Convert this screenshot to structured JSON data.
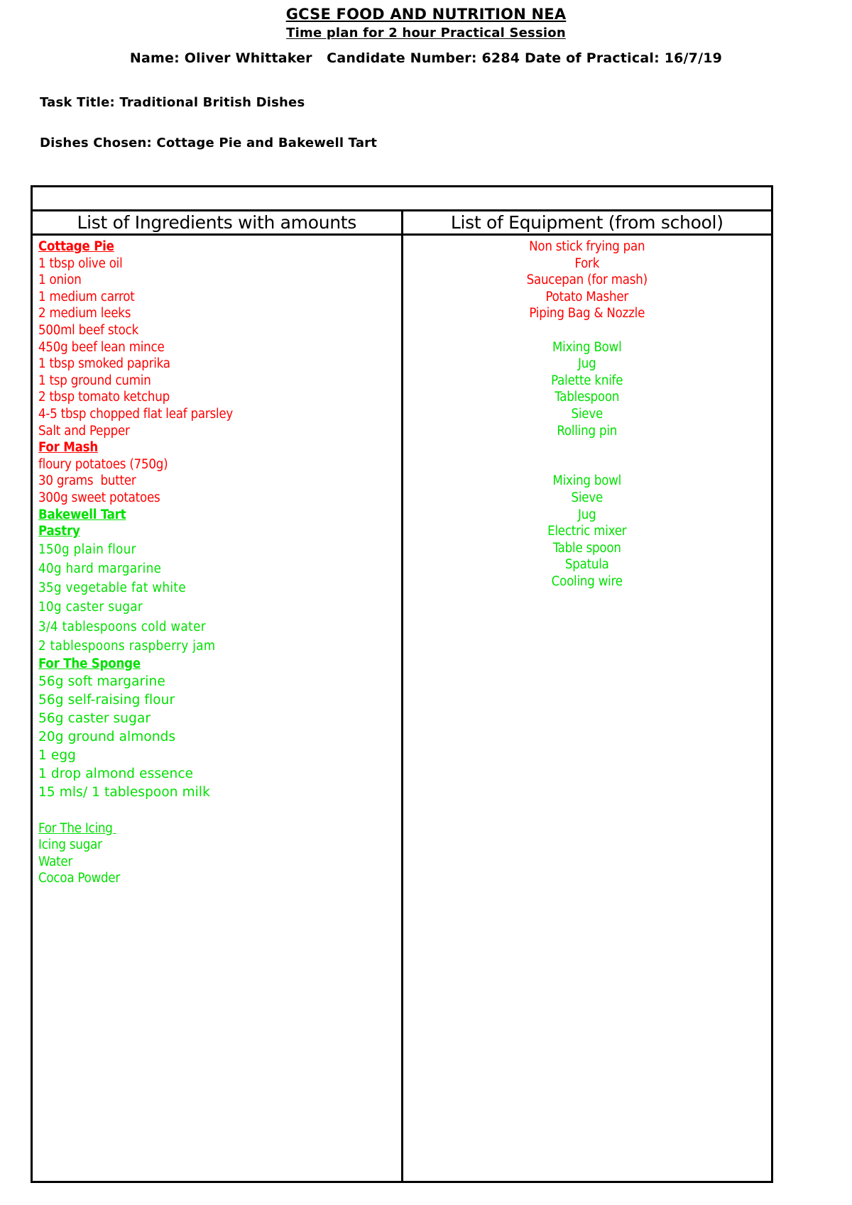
{
  "document": {
    "title_line_1": "GCSE FOOD AND NUTRITION NEA ",
    "title_line_2": "Time plan for 2 hour Practical Session  ",
    "name_label": "Name: ",
    "name_value": "Oliver Whittaker",
    "candidate_label": "   Candidate Number: ",
    "candidate_value": "6284",
    "date_label": " Date of Practical: ",
    "date_value": "16/7/19",
    "task_title_label": "Task Title: ",
    "task_title_value": "Traditional British Dishes",
    "dishes_chosen_label": "Dishes Chosen: ",
    "dishes_chosen_value": "Cottage Pie and Bakewell Tart"
  },
  "colors": {
    "red": "#ff0000",
    "green": "#00e000",
    "black": "#000000",
    "border": "#000000"
  },
  "table": {
    "blank_row": "",
    "headers": {
      "ingredients": "List of Ingredients with amounts",
      "equipment": "List of Equipment (from school)"
    },
    "ingredients": [
      {
        "text": "Cottage Pie",
        "color": "#ff0000",
        "bold": true,
        "underline": true,
        "font": "condensed"
      },
      {
        "text": "1 tbsp olive oil",
        "color": "#ff0000",
        "bold": false,
        "underline": false,
        "font": "condensed"
      },
      {
        "text": "1 onion",
        "color": "#ff0000",
        "bold": false,
        "underline": false,
        "font": "condensed"
      },
      {
        "text": "1 medium carrot",
        "color": "#ff0000",
        "bold": false,
        "underline": false,
        "font": "condensed"
      },
      {
        "text": "2 medium leeks",
        "color": "#ff0000",
        "bold": false,
        "underline": false,
        "font": "condensed"
      },
      {
        "text": "500ml beef stock",
        "color": "#ff0000",
        "bold": false,
        "underline": false,
        "font": "condensed"
      },
      {
        "text": "450g beef lean mince",
        "color": "#ff0000",
        "bold": false,
        "underline": false,
        "font": "condensed"
      },
      {
        "text": "1 tbsp smoked paprika",
        "color": "#ff0000",
        "bold": false,
        "underline": false,
        "font": "condensed"
      },
      {
        "text": "1 tsp ground cumin",
        "color": "#ff0000",
        "bold": false,
        "underline": false,
        "font": "condensed"
      },
      {
        "text": "2 tbsp tomato ketchup",
        "color": "#ff0000",
        "bold": false,
        "underline": false,
        "font": "condensed"
      },
      {
        "text": "4-5 tbsp chopped flat leaf parsley",
        "color": "#ff0000",
        "bold": false,
        "underline": false,
        "font": "condensed"
      },
      {
        "text": "Salt and Pepper",
        "color": "#ff0000",
        "bold": false,
        "underline": false,
        "font": "condensed"
      },
      {
        "text": "For Mash",
        "color": "#ff0000",
        "bold": true,
        "underline": true,
        "font": "condensed"
      },
      {
        "text": "floury potatoes (750g)",
        "color": "#ff0000",
        "bold": false,
        "underline": false,
        "font": "condensed"
      },
      {
        "text": "30 grams  butter",
        "color": "#ff0000",
        "bold": false,
        "underline": false,
        "font": "condensed"
      },
      {
        "text": "300g sweet potatoes",
        "color": "#ff0000",
        "bold": false,
        "underline": false,
        "font": "condensed"
      },
      {
        "text": "Bakewell Tart",
        "color": "#00e000",
        "bold": true,
        "underline": true,
        "font": "condensed"
      },
      {
        "text": "Pastry",
        "color": "#00e000",
        "bold": true,
        "underline": true,
        "font": "condensed"
      },
      {
        "text": "150g plain flour",
        "color": "#00e000",
        "bold": false,
        "underline": false,
        "font": "alt"
      },
      {
        "text": "40g hard margarine",
        "color": "#00e000",
        "bold": false,
        "underline": false,
        "font": "alt"
      },
      {
        "text": "35g vegetable fat white",
        "color": "#00e000",
        "bold": false,
        "underline": false,
        "font": "alt"
      },
      {
        "text": "10g caster sugar",
        "color": "#00e000",
        "bold": false,
        "underline": false,
        "font": "alt"
      },
      {
        "text": "3/4 tablespoons cold water",
        "color": "#00e000",
        "bold": false,
        "underline": false,
        "font": "alt"
      },
      {
        "text": "2 tablespoons raspberry jam",
        "color": "#00e000",
        "bold": false,
        "underline": false,
        "font": "alt"
      },
      {
        "text": "For The Sponge",
        "color": "#00e000",
        "bold": true,
        "underline": true,
        "font": "condensed"
      },
      {
        "text": "56g soft margarine",
        "color": "#00e000",
        "bold": false,
        "underline": false,
        "font": "alt2"
      },
      {
        "text": "56g self-raising flour",
        "color": "#00e000",
        "bold": false,
        "underline": false,
        "font": "alt2"
      },
      {
        "text": "56g caster sugar",
        "color": "#00e000",
        "bold": false,
        "underline": false,
        "font": "alt2"
      },
      {
        "text": "20g ground almonds",
        "color": "#00e000",
        "bold": false,
        "underline": false,
        "font": "alt2"
      },
      {
        "text": "1 egg",
        "color": "#00e000",
        "bold": false,
        "underline": false,
        "font": "alt2"
      },
      {
        "text": "1 drop almond essence",
        "color": "#00e000",
        "bold": false,
        "underline": false,
        "font": "alt2"
      },
      {
        "text": "15 mls/ 1 tablespoon milk",
        "color": "#00e000",
        "bold": false,
        "underline": false,
        "font": "alt2"
      },
      {
        "text": "",
        "color": "#00e000",
        "bold": false,
        "underline": false,
        "font": "alt2"
      },
      {
        "text": "For The Icing ",
        "color": "#00e000",
        "bold": false,
        "underline": true,
        "font": "condensed"
      },
      {
        "text": "Icing sugar",
        "color": "#00e000",
        "bold": false,
        "underline": false,
        "font": "condensed"
      },
      {
        "text": "Water",
        "color": "#00e000",
        "bold": false,
        "underline": false,
        "font": "condensed"
      },
      {
        "text": "Cocoa Powder",
        "color": "#00e000",
        "bold": false,
        "underline": false,
        "font": "condensed"
      }
    ],
    "equipment": [
      {
        "text": "Non stick frying pan",
        "color": "#ff0000"
      },
      {
        "text": "Fork",
        "color": "#ff0000"
      },
      {
        "text": "Saucepan (for mash)",
        "color": "#ff0000"
      },
      {
        "text": "Potato Masher",
        "color": "#ff0000"
      },
      {
        "text": "Piping Bag & Nozzle",
        "color": "#ff0000"
      },
      {
        "text": "",
        "color": "#ff0000"
      },
      {
        "text": "Mixing Bowl",
        "color": "#00e000"
      },
      {
        "text": "Jug",
        "color": "#00e000"
      },
      {
        "text": "Palette knife",
        "color": "#00e000"
      },
      {
        "text": "Tablespoon",
        "color": "#00e000"
      },
      {
        "text": "Sieve",
        "color": "#00e000"
      },
      {
        "text": "Rolling pin",
        "color": "#00e000"
      },
      {
        "text": "",
        "color": "#00e000"
      },
      {
        "text": "",
        "color": "#00e000"
      },
      {
        "text": "Mixing bowl",
        "color": "#00e000"
      },
      {
        "text": "Sieve",
        "color": "#00e000"
      },
      {
        "text": "Jug",
        "color": "#00e000"
      },
      {
        "text": "Electric mixer",
        "color": "#00e000"
      },
      {
        "text": "Table spoon",
        "color": "#00e000"
      },
      {
        "text": "Spatula",
        "color": "#00e000"
      },
      {
        "text": "Cooling wire",
        "color": "#00e000"
      }
    ]
  }
}
